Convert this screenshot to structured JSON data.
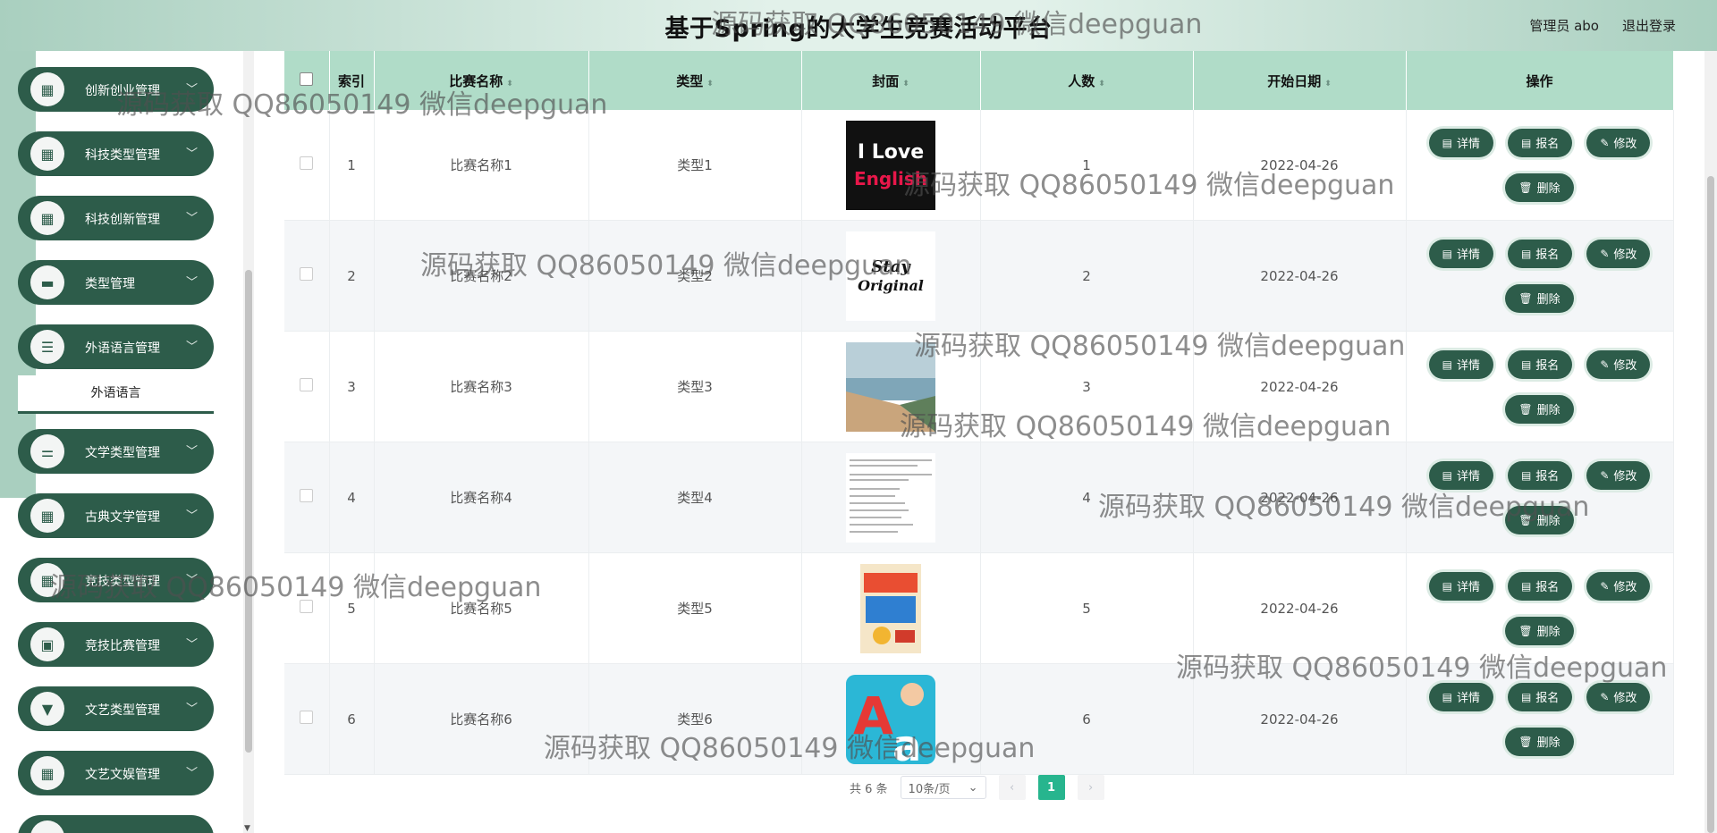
{
  "header": {
    "title": "基于Spring的大学生竞赛活动平台",
    "user": "管理员 abo",
    "logout": "退出登录"
  },
  "sidebar": {
    "items": [
      {
        "label": "创新创业管理",
        "icon": "grid-icon"
      },
      {
        "label": "科技类型管理",
        "icon": "grid-icon"
      },
      {
        "label": "科技创新管理",
        "icon": "grid-icon"
      },
      {
        "label": "类型管理",
        "icon": "book-icon"
      },
      {
        "label": "外语语言管理",
        "icon": "list-icon"
      },
      {
        "label": "文学类型管理",
        "icon": "sliders-icon"
      },
      {
        "label": "古典文学管理",
        "icon": "grid-icon"
      },
      {
        "label": "竞技类型管理",
        "icon": "grid-icon"
      },
      {
        "label": "竞技比赛管理",
        "icon": "clipboard-icon"
      },
      {
        "label": "文艺类型管理",
        "icon": "trophy-icon"
      },
      {
        "label": "文艺文娱管理",
        "icon": "grid-icon"
      }
    ],
    "submenu": "外语语言"
  },
  "table": {
    "headers": {
      "index": "索引",
      "name": "比赛名称",
      "type": "类型",
      "cover": "封面",
      "count": "人数",
      "date": "开始日期",
      "ops": "操作"
    },
    "rows": [
      {
        "index": "1",
        "name": "比赛名称1",
        "type": "类型1",
        "count": "1",
        "date": "2022-04-26"
      },
      {
        "index": "2",
        "name": "比赛名称2",
        "type": "类型2",
        "count": "2",
        "date": "2022-04-26"
      },
      {
        "index": "3",
        "name": "比赛名称3",
        "type": "类型3",
        "count": "3",
        "date": "2022-04-26"
      },
      {
        "index": "4",
        "name": "比赛名称4",
        "type": "类型4",
        "count": "4",
        "date": "2022-04-26"
      },
      {
        "index": "5",
        "name": "比赛名称5",
        "type": "类型5",
        "count": "5",
        "date": "2022-04-26"
      },
      {
        "index": "6",
        "name": "比赛名称6",
        "type": "类型6",
        "count": "6",
        "date": "2022-04-26"
      }
    ],
    "buttons": {
      "detail": "详情",
      "signup": "报名",
      "edit": "修改",
      "delete": "删除"
    }
  },
  "covers": [
    {
      "text": "I Love English",
      "bg": "#111111",
      "fg": "#e8174a"
    },
    {
      "text": "Stay Original",
      "bg": "#ffffff",
      "fg": "#111111"
    },
    {
      "text": "",
      "bg": "#7fa6b8",
      "fg": "#c9a57c"
    },
    {
      "text": "",
      "bg": "#ffffff",
      "fg": "#888888"
    },
    {
      "text": "",
      "bg": "#f5e6c8",
      "fg": "#d13b2b"
    },
    {
      "text": "Aa",
      "bg": "#2bb7d6",
      "fg": "#ffffff"
    }
  ],
  "pagination": {
    "total": "共 6 条",
    "page_size": "10条/页",
    "current": "1"
  },
  "watermark": "源码获取 QQ86050149 微信deepguan",
  "colors": {
    "accent": "#2d5c4a",
    "header_row": "#b0dcc8",
    "page_active": "#27b58e"
  }
}
